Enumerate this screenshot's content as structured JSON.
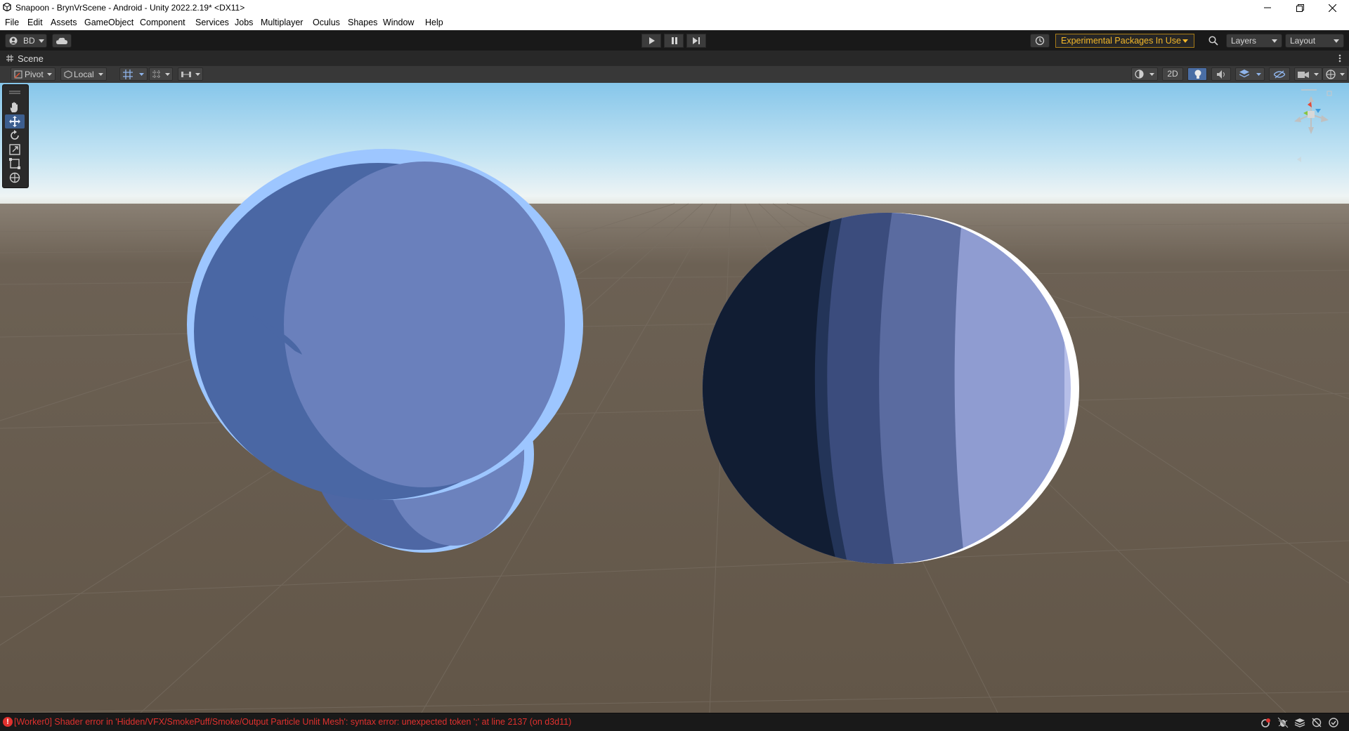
{
  "window": {
    "title": "Snapoon - BrynVrScene - Android - Unity 2022.2.19* <DX11>",
    "app_icon": "unity-logo-icon",
    "controls": [
      "minimize",
      "restore",
      "close"
    ]
  },
  "menu": [
    "File",
    "Edit",
    "Assets",
    "GameObject",
    "Component",
    "Services",
    "Jobs",
    "Multiplayer",
    "Oculus",
    "Shapes",
    "Window",
    "Help"
  ],
  "toolbar": {
    "account_label": "BD",
    "experimental_label": "Experimental Packages In Use",
    "layers_label": "Layers",
    "layout_label": "Layout"
  },
  "scene": {
    "tab_label": "Scene",
    "pivot_label": "Pivot",
    "local_label": "Local",
    "mode_2d_label": "2D"
  },
  "status": {
    "message": "[Worker0] Shader error in 'Hidden/VFX/SmokePuff/Smoke/Output Particle Unlit Mesh': syntax error: unexpected token ';' at line 2137 (on d3d11)"
  },
  "colors": {
    "accent": "#3c5e8f",
    "warning": "#f4b829",
    "error": "#e0312e",
    "ground": "#625648",
    "sky_top": "#86c6ea"
  }
}
